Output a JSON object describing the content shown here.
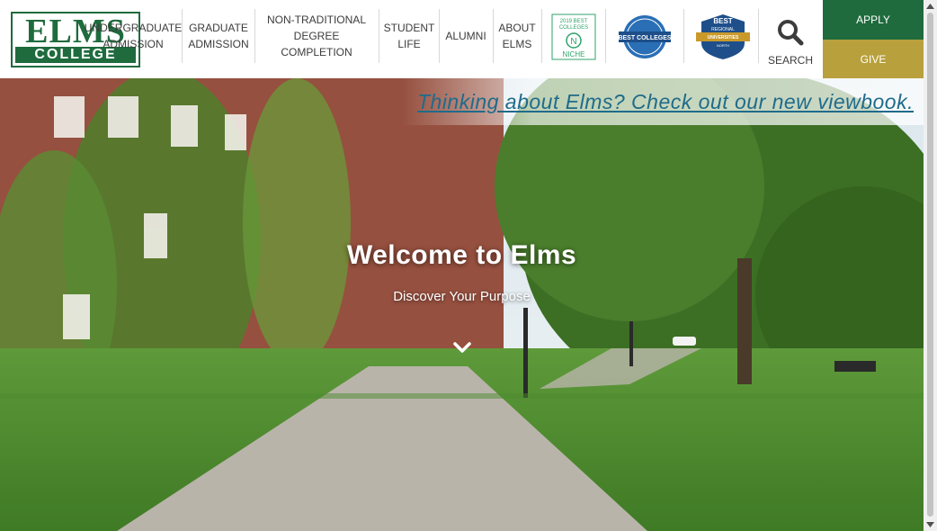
{
  "logo": {
    "top": "ELMS",
    "bottom": "COLLEGE"
  },
  "nav": [
    {
      "label": "UNDERGRADUATE ADMISSION"
    },
    {
      "label": "GRADUATE ADMISSION"
    },
    {
      "label": "NON-TRADITIONAL DEGREE COMPLETION"
    },
    {
      "label": "STUDENT LIFE"
    },
    {
      "label": "ALUMNI"
    },
    {
      "label": "ABOUT ELMS"
    }
  ],
  "badges": [
    {
      "name": "niche-best-colleges-badge",
      "line1": "2019 BEST",
      "line2": "COLLEGES",
      "line3": "NICHE"
    },
    {
      "name": "us-news-best-colleges-badge",
      "line1": "BEST COLLEGES"
    },
    {
      "name": "us-news-best-regional-badge",
      "line1": "BEST",
      "line2": "REGIONAL",
      "line3": "UNIVERSITIES",
      "line4": "NORTH"
    }
  ],
  "search": {
    "label": "SEARCH"
  },
  "cta": {
    "apply": "APPLY",
    "give": "GIVE"
  },
  "hero": {
    "banner": "Thinking about Elms? Check out our new viewbook.",
    "title": "Welcome to Elms",
    "subtitle": "Discover Your Purpose"
  },
  "colors": {
    "brand_green": "#1f6b3d",
    "gold": "#b8a03c",
    "link_blue": "#1f6b8a"
  }
}
